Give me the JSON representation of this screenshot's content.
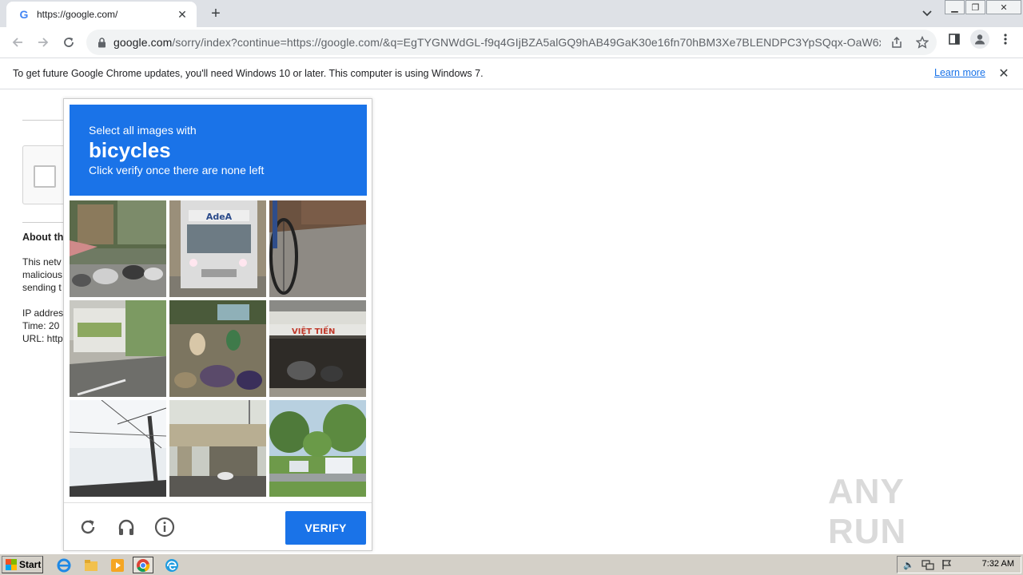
{
  "browser": {
    "tab": {
      "title": "https://google.com/",
      "favicon": "G"
    },
    "url": {
      "host": "google.com",
      "path": "/sorry/index?continue=https://google.com/&q=EgTYGNWdGL-f9q4GIjBZA5alGQ9hAB49GaK30e16fn70hBM3Xe7BLENDPC3YpSQqx-OaW6xwL..."
    }
  },
  "infobar": {
    "message": "To get future Google Chrome updates, you'll need Windows 10 or later. This computer is using Windows 7.",
    "link": "Learn more"
  },
  "background_page": {
    "heading": "About th",
    "para_lines": [
      "This netv",
      "malicious",
      "sending t"
    ],
    "meta_lines": [
      "IP addres",
      "Time: 20",
      "URL: http"
    ]
  },
  "captcha": {
    "instruction": "Select all images with",
    "target": "bicycles",
    "hint": "Click verify once there are none left",
    "verify_label": "VERIFY",
    "tiles": [
      "street-scooters-tile",
      "truck-adea-tile",
      "bicycle-wheel-tile",
      "street-hedge-tile",
      "market-motorbikes-tile",
      "shop-viet-tien-tile",
      "power-pole-tile",
      "overpass-tile",
      "palm-trees-tile"
    ],
    "tile_text": {
      "truck": "AdeA",
      "shop": "VIỆT TIẾN"
    }
  },
  "watermark": "ANY RUN",
  "taskbar": {
    "start_label": "Start",
    "clock": "7:32 AM"
  },
  "colors": {
    "accent": "#1a73e8",
    "tab_strip": "#dee1e6",
    "taskbar": "#d4d0c8"
  }
}
